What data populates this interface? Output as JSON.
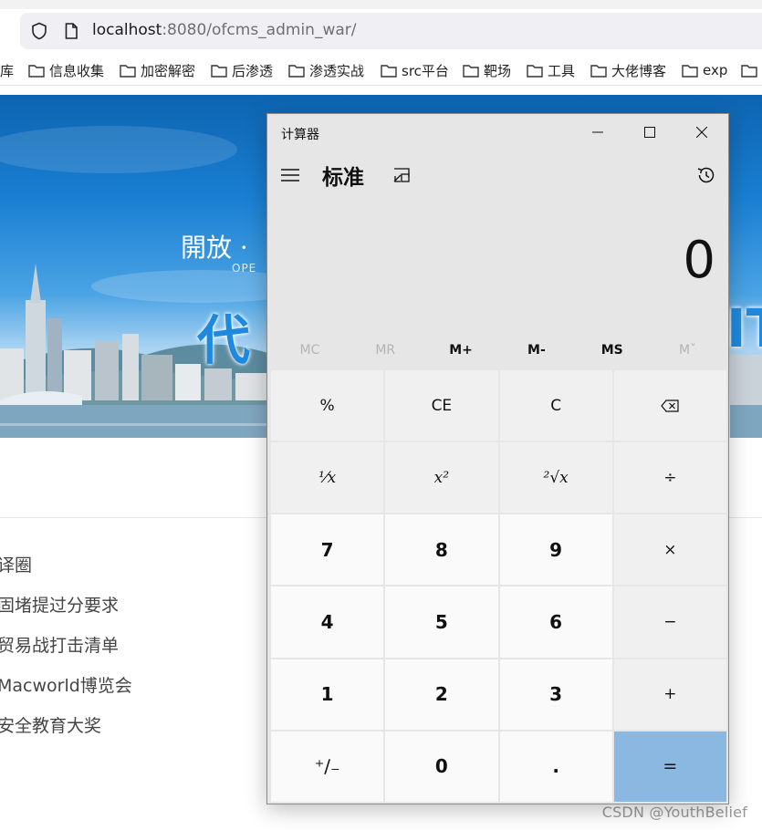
{
  "browser": {
    "url_host": "localhost",
    "url_rest": ":8080/ofcms_admin_war/"
  },
  "bookmarks": [
    {
      "label": "库",
      "has_folder": false
    },
    {
      "label": "信息收集",
      "has_folder": true
    },
    {
      "label": "加密解密",
      "has_folder": true
    },
    {
      "label": "后渗透",
      "has_folder": true
    },
    {
      "label": "渗透实战",
      "has_folder": true
    },
    {
      "label": "src平台",
      "has_folder": true
    },
    {
      "label": "靶场",
      "has_folder": true
    },
    {
      "label": "工具",
      "has_folder": true
    },
    {
      "label": "大佬博客",
      "has_folder": true
    },
    {
      "label": "exp",
      "has_folder": true
    }
  ],
  "banner": {
    "slogan": "開放 · ",
    "sub_slogan": "OPE",
    "big_text": "代",
    "big_text_right": "IT"
  },
  "news": [
    "译圈",
    "固堵提过分要求",
    "贸易战打击清单",
    " Macworld博览会",
    "安全教育大奖"
  ],
  "calculator": {
    "window_title": "计算器",
    "mode": "标准",
    "display": "0",
    "memory_buttons": [
      {
        "label": "MC",
        "enabled": false
      },
      {
        "label": "MR",
        "enabled": false
      },
      {
        "label": "M+",
        "enabled": true
      },
      {
        "label": "M-",
        "enabled": true
      },
      {
        "label": "MS",
        "enabled": true
      },
      {
        "label": "Mˇ",
        "enabled": false
      }
    ],
    "keys": {
      "percent": "%",
      "ce": "CE",
      "clear": "C",
      "reciprocal": "⅟x",
      "square": "x²",
      "sqrt": "²√x",
      "divide": "÷",
      "seven": "7",
      "eight": "8",
      "nine": "9",
      "multiply": "×",
      "four": "4",
      "five": "5",
      "six": "6",
      "minus": "−",
      "one": "1",
      "two": "2",
      "three": "3",
      "plus": "+",
      "negate": "⁺∕₋",
      "zero": "0",
      "decimal": ".",
      "equals": "="
    },
    "accent_color": "#8ab8e0"
  },
  "watermark": "CSDN @YouthBelief"
}
